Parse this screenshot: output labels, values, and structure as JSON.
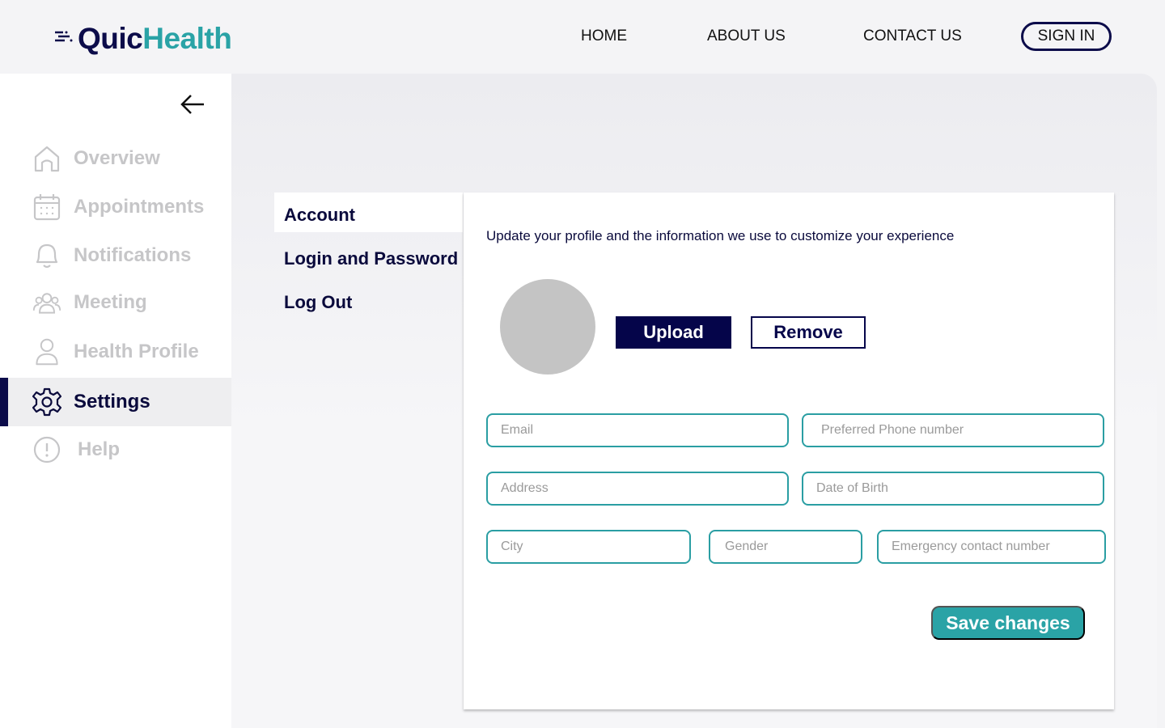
{
  "header": {
    "logo": {
      "part1": "Quic",
      "part2": "Health"
    },
    "nav": {
      "home": "HOME",
      "about": "ABOUT US",
      "contact": "CONTACT US"
    },
    "signin": "SIGN IN"
  },
  "sidebar": {
    "items": [
      {
        "label": "Overview",
        "icon": "home-icon"
      },
      {
        "label": "Appointments",
        "icon": "calendar-icon"
      },
      {
        "label": "Notifications",
        "icon": "bell-icon"
      },
      {
        "label": "Meeting",
        "icon": "group-icon"
      },
      {
        "label": "Health Profile",
        "icon": "user-icon"
      },
      {
        "label": "Settings",
        "icon": "gear-icon",
        "active": true
      },
      {
        "label": "Help",
        "icon": "info-icon"
      }
    ]
  },
  "settings_menu": {
    "items": [
      "Account",
      "Login and Password",
      "Log Out"
    ],
    "active": "Account"
  },
  "account": {
    "description": "Update your profile and the information we use to customize your experience",
    "upload_label": "Upload",
    "remove_label": "Remove",
    "fields": {
      "email": "Email",
      "phone": "Preferred Phone number",
      "address": "Address",
      "dob": "Date of Birth",
      "city": "City",
      "gender": "Gender",
      "emergency": "Emergency contact number"
    },
    "save_label": "Save changes"
  },
  "colors": {
    "brand_navy": "#0c0c4a",
    "brand_teal": "#2aa3a6",
    "inactive_text": "#c6c6c8"
  }
}
